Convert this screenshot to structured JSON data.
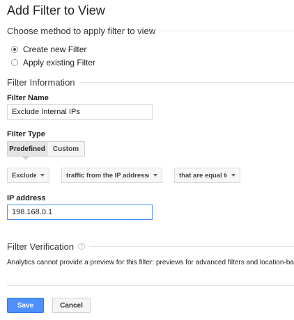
{
  "page": {
    "title": "Add Filter to View"
  },
  "method": {
    "heading": "Choose method to apply filter to view",
    "options": [
      {
        "label": "Create new Filter",
        "selected": true
      },
      {
        "label": "Apply existing Filter",
        "selected": false
      }
    ]
  },
  "filter_info": {
    "heading": "Filter Information",
    "name_label": "Filter Name",
    "name_value": "Exclude Internal IPs",
    "type_label": "Filter Type",
    "type_tabs": [
      {
        "label": "Predefined",
        "active": true
      },
      {
        "label": "Custom",
        "active": false
      }
    ],
    "dropdowns": {
      "action": "Exclude",
      "source": "traffic from the IP addresses",
      "operator": "that are equal to"
    },
    "ip_label": "IP address",
    "ip_value": "198.168.0.1"
  },
  "verification": {
    "heading": "Filter Verification",
    "help_icon": "?",
    "message": "Analytics cannot provide a preview for this filter: previews for advanced filters and location-bas"
  },
  "actions": {
    "save": "Save",
    "cancel": "Cancel"
  },
  "colors": {
    "accent": "#4d90fe",
    "focus_border": "#4d90fe"
  }
}
